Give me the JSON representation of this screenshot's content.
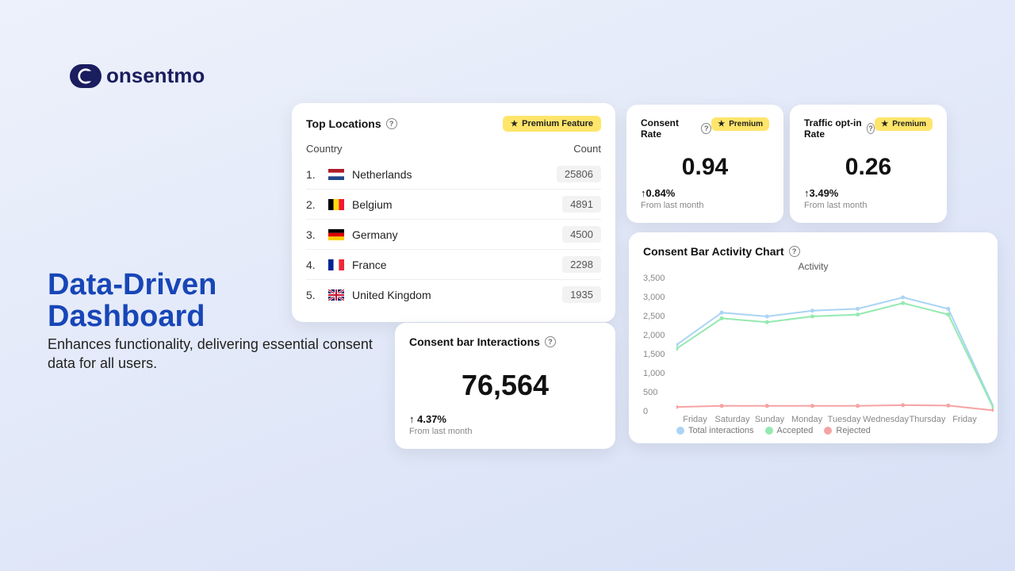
{
  "brand": {
    "name": "onsentmo",
    "mark_letter": "C"
  },
  "hero": {
    "title_line1": "Data-Driven",
    "title_line2": "Dashboard",
    "subtitle": "Enhances functionality, delivering essential consent data for all users."
  },
  "premium_labels": {
    "full": "Premium Feature",
    "short": "Premium"
  },
  "top_locations": {
    "title": "Top Locations",
    "header_country": "Country",
    "header_count": "Count",
    "rows": [
      {
        "rank": "1.",
        "name": "Netherlands",
        "count": "25806",
        "flag": "nl"
      },
      {
        "rank": "2.",
        "name": "Belgium",
        "count": "4891",
        "flag": "be"
      },
      {
        "rank": "3.",
        "name": "Germany",
        "count": "4500",
        "flag": "de"
      },
      {
        "rank": "4.",
        "name": "France",
        "count": "2298",
        "flag": "fr"
      },
      {
        "rank": "5.",
        "name": "United Kingdom",
        "count": "1935",
        "flag": "gb"
      }
    ]
  },
  "interactions": {
    "title": "Consent bar Interactions",
    "value": "76,564",
    "change": "4.37%",
    "from": "From last month"
  },
  "consent_rate": {
    "title": "Consent Rate",
    "value": "0.94",
    "change": "0.84%",
    "from": "From last month"
  },
  "traffic_rate": {
    "title": "Traffic opt-in Rate",
    "value": "0.26",
    "change": "3.49%",
    "from": "From last month"
  },
  "activity_chart": {
    "title": "Consent Bar Activity Chart",
    "subtitle": "Activity",
    "legend": {
      "total": "Total interactions",
      "accepted": "Accepted",
      "rejected": "Rejected"
    }
  },
  "chart_data": {
    "type": "line",
    "title": "Activity",
    "xlabel": "",
    "ylabel": "",
    "ylim": [
      0,
      3500
    ],
    "y_ticks": [
      "3,500",
      "3,000",
      "2,500",
      "2,000",
      "1,500",
      "1,000",
      "500",
      "0"
    ],
    "categories": [
      "Friday",
      "Saturday",
      "Sunday",
      "Monday",
      "Tuesday",
      "Wednesday",
      "Thursday",
      "Friday"
    ],
    "series": [
      {
        "name": "Total interactions",
        "color": "#aad4f5",
        "values": [
          1750,
          2600,
          2500,
          2650,
          2700,
          3000,
          2700,
          120
        ]
      },
      {
        "name": "Accepted",
        "color": "#94e9b0",
        "values": [
          1650,
          2450,
          2350,
          2500,
          2550,
          2850,
          2550,
          80
        ]
      },
      {
        "name": "Rejected",
        "color": "#f6a3a3",
        "values": [
          120,
          150,
          150,
          150,
          150,
          170,
          160,
          30
        ]
      }
    ]
  }
}
